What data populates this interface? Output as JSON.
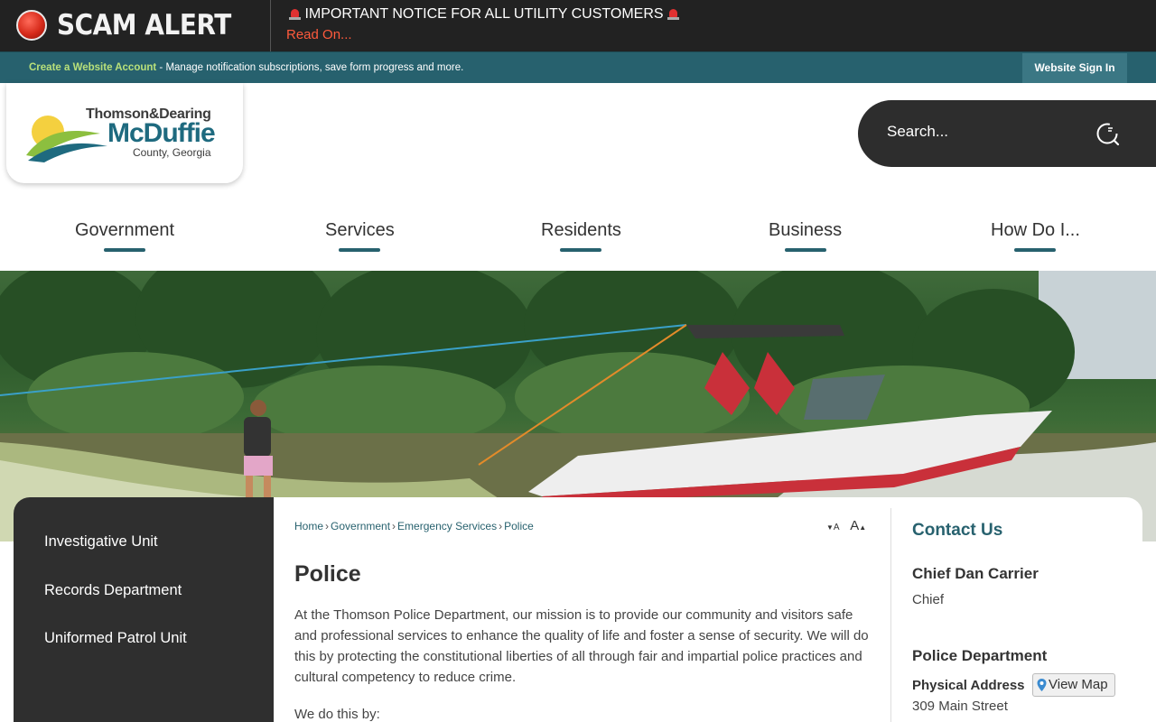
{
  "alert": {
    "title": "SCAM ALERT",
    "message": "IMPORTANT NOTICE FOR ALL UTILITY CUSTOMERS",
    "read_on": "Read On..."
  },
  "account_bar": {
    "create_link": "Create a Website Account",
    "description": " - Manage notification subscriptions, save form progress and more.",
    "sign_in": "Website Sign In"
  },
  "logo": {
    "line1": "Thomson&Dearing",
    "line2": "McDuffie",
    "line3": "County, Georgia"
  },
  "search": {
    "placeholder": "Search..."
  },
  "nav": {
    "items": [
      {
        "label": "Government"
      },
      {
        "label": "Services"
      },
      {
        "label": "Residents"
      },
      {
        "label": "Business"
      },
      {
        "label": "How Do I..."
      }
    ]
  },
  "sidebar": {
    "items": [
      {
        "label": "Investigative Unit"
      },
      {
        "label": "Records Department"
      },
      {
        "label": "Uniformed Patrol Unit"
      }
    ]
  },
  "breadcrumb": [
    "Home",
    "Government",
    "Emergency Services",
    "Police"
  ],
  "font_controls": {
    "decrease": "A",
    "increase": "A"
  },
  "main": {
    "title": "Police",
    "body": "At the Thomson Police Department, our mission is to provide our community and visitors safe and professional services to enhance the quality of life and foster a sense of security. We will do this by protecting the constitutional liberties of all through fair and impartial police practices and cultural competency to reduce crime.",
    "body2": "We do this by:"
  },
  "contact": {
    "heading": "Contact Us",
    "name": "Chief Dan Carrier",
    "role": "Chief",
    "department": "Police Department",
    "address_label": "Physical Address",
    "map_button": "View Map",
    "street": "309 Main Street"
  },
  "colors": {
    "alert_bg": "#222222",
    "account_bar": "#27616e",
    "accent": "#27616e",
    "read_on": "#ff5a3c",
    "sidebar_bg": "#2f2f2f"
  }
}
